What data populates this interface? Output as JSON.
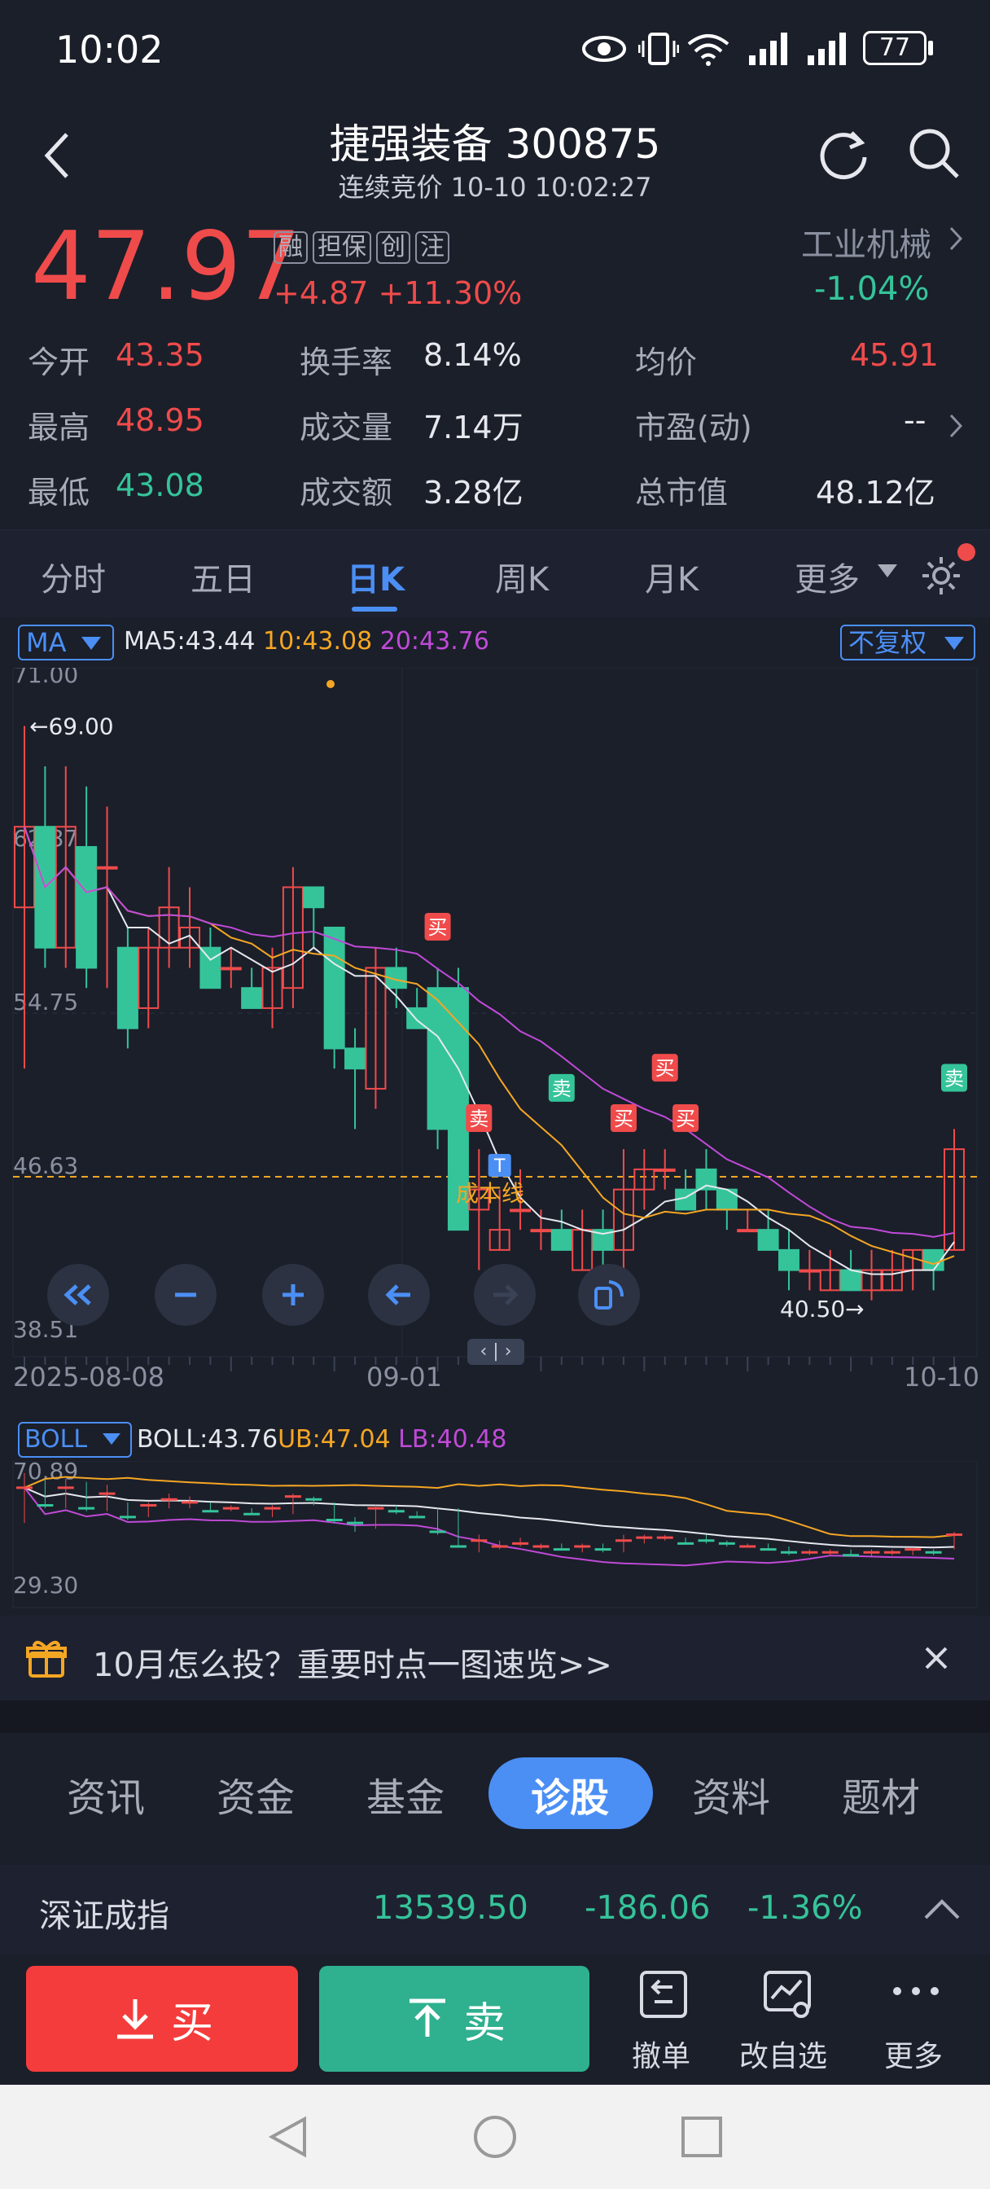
{
  "status_bar": {
    "time": "10:02",
    "battery": "77"
  },
  "header": {
    "title": "捷强装备 300875",
    "subtitle": "连续竞价 10-10 10:02:27"
  },
  "quote": {
    "price": "47.97",
    "change": "+4.87",
    "change_pct": "+11.30%",
    "tags": [
      "融",
      "担保",
      "创",
      "注"
    ],
    "industry": "工业机械",
    "industry_change": "-1.04%",
    "rows": [
      [
        {
          "label": "今开",
          "value": "43.35",
          "color": "#f04b4b"
        },
        {
          "label": "换手率",
          "value": "8.14%",
          "color": "#e6e8ee"
        },
        {
          "label": "均价",
          "value": "45.91",
          "color": "#f04b4b"
        }
      ],
      [
        {
          "label": "最高",
          "value": "48.95",
          "color": "#f04b4b"
        },
        {
          "label": "成交量",
          "value": "7.14万",
          "color": "#e6e8ee"
        },
        {
          "label": "市盈(动)",
          "value": "--",
          "color": "#e6e8ee"
        }
      ],
      [
        {
          "label": "最低",
          "value": "43.08",
          "color": "#35c49a"
        },
        {
          "label": "成交额",
          "value": "3.28亿",
          "color": "#e6e8ee"
        },
        {
          "label": "总市值",
          "value": "48.12亿",
          "color": "#e6e8ee"
        }
      ]
    ]
  },
  "periods": [
    "分时",
    "五日",
    "日K",
    "周K",
    "月K",
    "更多"
  ],
  "active_period": "日K",
  "chart": {
    "indicator": "MA",
    "ma5": "MA5:43.44",
    "ma10": "10:43.08",
    "ma20": "20:43.76",
    "adjust": "不复权",
    "y_labels": [
      "71.00",
      "62.87",
      "54.75",
      "46.63",
      "38.51"
    ],
    "high_note": "←69.00",
    "low_note": "40.50→",
    "cost_label": "成本线",
    "date_start": "2025-08-08",
    "date_mid": "09-01",
    "date_end": "10-10",
    "signals": [
      {
        "t": "买"
      },
      {
        "t": "卖"
      },
      {
        "t": "卖"
      },
      {
        "t": "买"
      },
      {
        "t": "买"
      },
      {
        "t": "买"
      },
      {
        "t": "卖"
      }
    ],
    "t_marker": "T"
  },
  "boll": {
    "name": "BOLL",
    "boll": "BOLL:43.76",
    "ub": "UB:47.04",
    "lb": "LB:40.48",
    "y_top": "70.89",
    "y_bottom": "29.30"
  },
  "promo": {
    "text": "10月怎么投？重要时点一图速览>>"
  },
  "info_tabs": [
    "资讯",
    "资金",
    "基金",
    "诊股",
    "资料",
    "题材"
  ],
  "active_info_tab": "诊股",
  "index": {
    "name": "深证成指",
    "value": "13539.50",
    "change": "-186.06",
    "pct": "-1.36%"
  },
  "trade": {
    "buy": "买",
    "sell": "卖",
    "cancel": "撤单",
    "edit": "改自选",
    "more": "更多"
  },
  "colors": {
    "up": "#f04b4b",
    "down": "#35c49a",
    "accent": "#4b8ff5",
    "bg": "#1b1f2a"
  }
}
